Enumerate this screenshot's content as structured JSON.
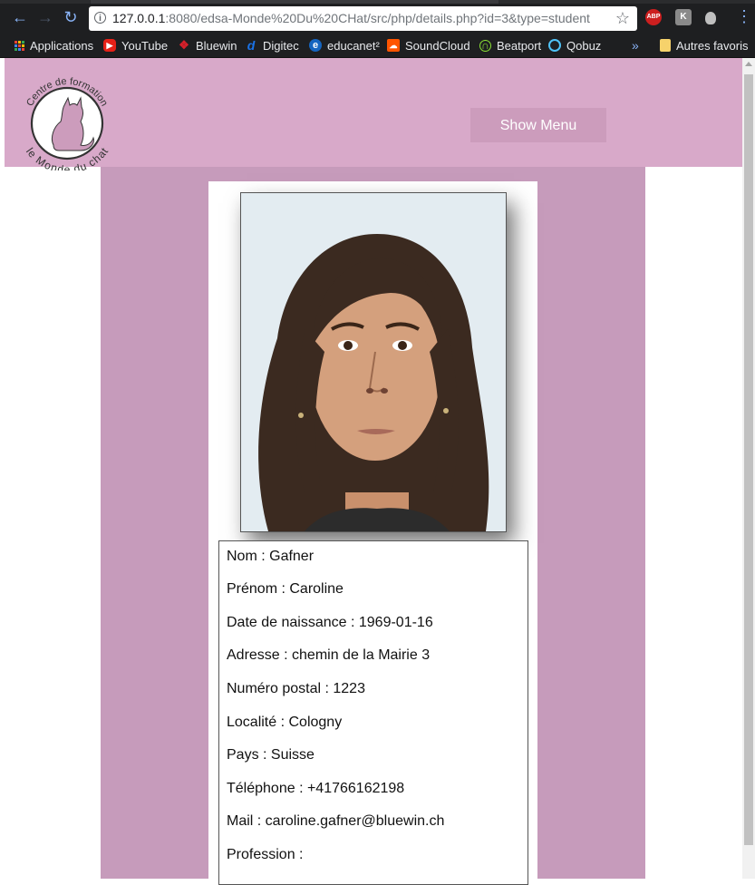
{
  "browser": {
    "url_host": "127.0.0.1",
    "url_rest": ":8080/edsa-Monde%20Du%20CHat/src/php/details.php?id=3&type=student",
    "extensions": [
      "ABP",
      "K"
    ]
  },
  "bookmarks": [
    {
      "label": "Applications",
      "icon": "apps-grid-icon"
    },
    {
      "label": "YouTube",
      "icon": "youtube-icon",
      "color": "#e62117"
    },
    {
      "label": "Bluewin",
      "icon": "bluewin-icon",
      "color": "#d6202a"
    },
    {
      "label": "Digitec",
      "icon": "digitec-icon",
      "color": "#1a73e8"
    },
    {
      "label": "educanet²",
      "icon": "educanet-icon",
      "color": "#1565c0"
    },
    {
      "label": "SoundCloud",
      "icon": "soundcloud-icon",
      "color": "#ff5500"
    },
    {
      "label": "Beatport",
      "icon": "beatport-icon",
      "color": "#8ae234"
    },
    {
      "label": "Qobuz",
      "icon": "qobuz-icon",
      "color": "#4fc3f7"
    },
    {
      "label": "»",
      "icon": "chevron-double-right-icon"
    },
    {
      "label": "Autres favoris",
      "icon": "folder-icon",
      "color": "#f6d26b"
    }
  ],
  "header": {
    "logo_top_text": "Centre de formation",
    "logo_bottom_text": "le Monde du chat",
    "show_menu_label": "Show Menu",
    "brand_color": "#d8a9c9",
    "content_color": "#c69bbb"
  },
  "student": {
    "nom": "Nom : Gafner",
    "prenom": "Prénom : Caroline",
    "naissance": "Date de naissance : 1969-01-16",
    "adresse": "Adresse : chemin de la Mairie 3",
    "postal": "Numéro postal : 1223",
    "localite": "Localité : Cologny",
    "pays": "Pays : Suisse",
    "telephone": "Téléphone : +41766162198",
    "mail": "Mail : caroline.gafner@bluewin.ch",
    "profession": "Profession :"
  }
}
